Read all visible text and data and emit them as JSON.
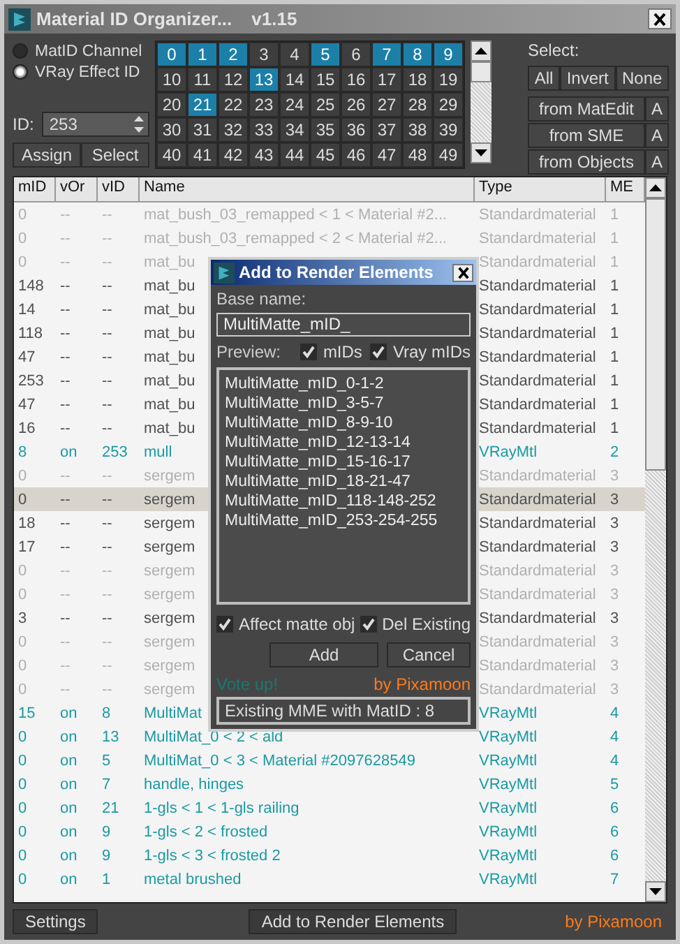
{
  "window": {
    "title": "Material ID Organizer...",
    "version": "v1.15"
  },
  "id_mode": [
    {
      "label": "MatID Channel",
      "selected": false
    },
    {
      "label": "VRay Effect ID",
      "selected": true
    }
  ],
  "id_field": {
    "label": "ID:",
    "value": "253"
  },
  "id_buttons": [
    "Assign",
    "Select"
  ],
  "id_grid": [
    {
      "label": "0",
      "selected": true
    },
    {
      "label": "1",
      "selected": true
    },
    {
      "label": "2",
      "selected": true
    },
    {
      "label": "3",
      "selected": false
    },
    {
      "label": "4",
      "selected": false
    },
    {
      "label": "5",
      "selected": true
    },
    {
      "label": "6",
      "selected": false
    },
    {
      "label": "7",
      "selected": true
    },
    {
      "label": "8",
      "selected": true
    },
    {
      "label": "9",
      "selected": true
    },
    {
      "label": "10",
      "selected": false
    },
    {
      "label": "11",
      "selected": false
    },
    {
      "label": "12",
      "selected": false
    },
    {
      "label": "13",
      "selected": true
    },
    {
      "label": "14",
      "selected": false
    },
    {
      "label": "15",
      "selected": false
    },
    {
      "label": "16",
      "selected": false
    },
    {
      "label": "17",
      "selected": false
    },
    {
      "label": "18",
      "selected": false
    },
    {
      "label": "19",
      "selected": false
    },
    {
      "label": "20",
      "selected": false
    },
    {
      "label": "21",
      "selected": true
    },
    {
      "label": "22",
      "selected": false
    },
    {
      "label": "23",
      "selected": false
    },
    {
      "label": "24",
      "selected": false
    },
    {
      "label": "25",
      "selected": false
    },
    {
      "label": "26",
      "selected": false
    },
    {
      "label": "27",
      "selected": false
    },
    {
      "label": "28",
      "selected": false
    },
    {
      "label": "29",
      "selected": false
    },
    {
      "label": "30",
      "selected": false
    },
    {
      "label": "31",
      "selected": false
    },
    {
      "label": "32",
      "selected": false
    },
    {
      "label": "33",
      "selected": false
    },
    {
      "label": "34",
      "selected": false
    },
    {
      "label": "35",
      "selected": false
    },
    {
      "label": "36",
      "selected": false
    },
    {
      "label": "37",
      "selected": false
    },
    {
      "label": "38",
      "selected": false
    },
    {
      "label": "39",
      "selected": false
    },
    {
      "label": "40",
      "selected": false
    },
    {
      "label": "41",
      "selected": false
    },
    {
      "label": "42",
      "selected": false
    },
    {
      "label": "43",
      "selected": false
    },
    {
      "label": "44",
      "selected": false
    },
    {
      "label": "45",
      "selected": false
    },
    {
      "label": "46",
      "selected": false
    },
    {
      "label": "47",
      "selected": false
    },
    {
      "label": "48",
      "selected": false
    },
    {
      "label": "49",
      "selected": false
    }
  ],
  "select": {
    "label": "Select:",
    "buttons": [
      "All",
      "Invert",
      "None"
    ],
    "sources": [
      {
        "label": "from MatEdit",
        "auto": "A"
      },
      {
        "label": "from SME",
        "auto": "A"
      },
      {
        "label": "from Objects",
        "auto": "A"
      }
    ]
  },
  "table": {
    "columns": [
      "mID",
      "vOr",
      "vID",
      "Name",
      "Type",
      "ME"
    ],
    "rows": [
      {
        "kind": "unused",
        "selected": false,
        "cells": [
          "0",
          "--",
          "--",
          "mat_bush_03_remapped < 1 < Material #2...",
          "Standardmaterial",
          "1"
        ]
      },
      {
        "kind": "unused",
        "selected": false,
        "cells": [
          "0",
          "--",
          "--",
          "mat_bush_03_remapped < 2 < Material #2...",
          "Standardmaterial",
          "1"
        ]
      },
      {
        "kind": "unused",
        "selected": false,
        "cells": [
          "0",
          "--",
          "--",
          "mat_bu",
          "Standardmaterial",
          "1"
        ]
      },
      {
        "kind": "standard",
        "selected": false,
        "cells": [
          "148",
          "--",
          "--",
          "mat_bu",
          "Standardmaterial",
          "1"
        ]
      },
      {
        "kind": "standard",
        "selected": false,
        "cells": [
          "14",
          "--",
          "--",
          "mat_bu",
          "Standardmaterial",
          "1"
        ]
      },
      {
        "kind": "standard",
        "selected": false,
        "cells": [
          "118",
          "--",
          "--",
          "mat_bu",
          "Standardmaterial",
          "1"
        ]
      },
      {
        "kind": "standard",
        "selected": false,
        "cells": [
          "47",
          "--",
          "--",
          "mat_bu",
          "Standardmaterial",
          "1"
        ]
      },
      {
        "kind": "standard",
        "selected": false,
        "cells": [
          "253",
          "--",
          "--",
          "mat_bu",
          "Standardmaterial",
          "1"
        ]
      },
      {
        "kind": "standard",
        "selected": false,
        "cells": [
          "47",
          "--",
          "--",
          "mat_bu",
          "Standardmaterial",
          "1"
        ]
      },
      {
        "kind": "standard",
        "selected": false,
        "cells": [
          "16",
          "--",
          "--",
          "mat_bu",
          "Standardmaterial",
          "1"
        ]
      },
      {
        "kind": "vray",
        "selected": false,
        "cells": [
          "8",
          "on",
          "253",
          "mull",
          "VRayMtl",
          "2"
        ]
      },
      {
        "kind": "unused",
        "selected": false,
        "cells": [
          "0",
          "--",
          "--",
          "sergem",
          "Standardmaterial",
          "3"
        ]
      },
      {
        "kind": "standard",
        "selected": true,
        "cells": [
          "0",
          "--",
          "--",
          "sergem",
          "Standardmaterial",
          "3"
        ]
      },
      {
        "kind": "standard",
        "selected": false,
        "cells": [
          "18",
          "--",
          "--",
          "sergem",
          "Standardmaterial",
          "3"
        ]
      },
      {
        "kind": "standard",
        "selected": false,
        "cells": [
          "17",
          "--",
          "--",
          "sergem",
          "Standardmaterial",
          "3"
        ]
      },
      {
        "kind": "unused",
        "selected": false,
        "cells": [
          "0",
          "--",
          "--",
          "sergem",
          "Standardmaterial",
          "3"
        ]
      },
      {
        "kind": "unused",
        "selected": false,
        "cells": [
          "0",
          "--",
          "--",
          "sergem",
          "Standardmaterial",
          "3"
        ]
      },
      {
        "kind": "standard",
        "selected": false,
        "cells": [
          "3",
          "--",
          "--",
          "sergem",
          "Standardmaterial",
          "3"
        ]
      },
      {
        "kind": "unused",
        "selected": false,
        "cells": [
          "0",
          "--",
          "--",
          "sergem",
          "Standardmaterial",
          "3"
        ]
      },
      {
        "kind": "unused",
        "selected": false,
        "cells": [
          "0",
          "--",
          "--",
          "sergem",
          "Standardmaterial",
          "3"
        ]
      },
      {
        "kind": "unused",
        "selected": false,
        "cells": [
          "0",
          "--",
          "--",
          "sergem",
          "Standardmaterial",
          "3"
        ]
      },
      {
        "kind": "vray",
        "selected": false,
        "cells": [
          "15",
          "on",
          "8",
          "MultiMat",
          "VRayMtl",
          "4"
        ]
      },
      {
        "kind": "vray",
        "selected": false,
        "cells": [
          "0",
          "on",
          "13",
          "MultiMat_0 < 2 < ald",
          "VRayMtl",
          "4"
        ]
      },
      {
        "kind": "vray",
        "selected": false,
        "cells": [
          "0",
          "on",
          "5",
          "MultiMat_0 < 3 < Material #2097628549",
          "VRayMtl",
          "4"
        ]
      },
      {
        "kind": "vray",
        "selected": false,
        "cells": [
          "0",
          "on",
          "7",
          "handle, hinges",
          "VRayMtl",
          "5"
        ]
      },
      {
        "kind": "vray",
        "selected": false,
        "cells": [
          "0",
          "on",
          "21",
          "1-gls < 1 < 1-gls railing",
          "VRayMtl",
          "6"
        ]
      },
      {
        "kind": "vray",
        "selected": false,
        "cells": [
          "0",
          "on",
          "9",
          "1-gls < 2 < frosted",
          "VRayMtl",
          "6"
        ]
      },
      {
        "kind": "vray",
        "selected": false,
        "cells": [
          "0",
          "on",
          "9",
          "1-gls < 3 < frosted 2",
          "VRayMtl",
          "6"
        ]
      },
      {
        "kind": "vray",
        "selected": false,
        "cells": [
          "0",
          "on",
          "1",
          "metal brushed",
          "VRayMtl",
          "7"
        ]
      }
    ]
  },
  "dialog": {
    "title": "Add to Render Elements",
    "base_name_label": "Base name:",
    "base_name": "MultiMatte_mID_",
    "preview_label": "Preview:",
    "preview_options": [
      {
        "label": "mIDs",
        "checked": true
      },
      {
        "label": "Vray mIDs",
        "checked": true
      }
    ],
    "preview": [
      "MultiMatte_mID_0-1-2",
      "MultiMatte_mID_3-5-7",
      "MultiMatte_mID_8-9-10",
      "MultiMatte_mID_12-13-14",
      "MultiMatte_mID_15-16-17",
      "MultiMatte_mID_18-21-47",
      "MultiMatte_mID_118-148-252",
      "MultiMatte_mID_253-254-255"
    ],
    "options": [
      {
        "label": "Affect matte obj",
        "checked": true
      },
      {
        "label": "Del Existing",
        "checked": true
      }
    ],
    "buttons": [
      "Add",
      "Cancel"
    ],
    "vote_link": "Vote up!",
    "credit": "by Pixamoon",
    "status": "Existing MME with MatID : 8"
  },
  "footer": {
    "buttons": [
      "Settings",
      "Add to Render Elements"
    ],
    "credit": "by Pixamoon"
  }
}
